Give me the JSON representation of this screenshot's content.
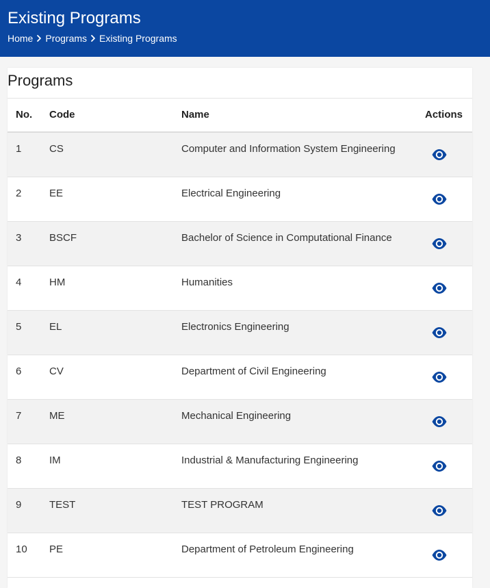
{
  "header": {
    "title": "Existing Programs",
    "breadcrumb": [
      "Home",
      "Programs",
      "Existing Programs"
    ]
  },
  "card": {
    "title": "Programs"
  },
  "table": {
    "columns": [
      "No.",
      "Code",
      "Name",
      "Actions"
    ],
    "rows": [
      {
        "no": "1",
        "code": "CS",
        "name": "Computer and Information System Engineering"
      },
      {
        "no": "2",
        "code": "EE",
        "name": "Electrical Engineering"
      },
      {
        "no": "3",
        "code": "BSCF",
        "name": "Bachelor of Science in Computational Finance"
      },
      {
        "no": "4",
        "code": "HM",
        "name": "Humanities"
      },
      {
        "no": "5",
        "code": "EL",
        "name": "Electronics Engineering"
      },
      {
        "no": "6",
        "code": "CV",
        "name": "Department of Civil Engineering"
      },
      {
        "no": "7",
        "code": "ME",
        "name": "Mechanical Engineering"
      },
      {
        "no": "8",
        "code": "IM",
        "name": "Industrial & Manufacturing Engineering"
      },
      {
        "no": "9",
        "code": "TEST",
        "name": "TEST PROGRAM"
      },
      {
        "no": "10",
        "code": "PE",
        "name": "Department of Petroleum Engineering"
      }
    ]
  },
  "icons": {
    "action": "eye-icon",
    "breadcrumb_separator": "chevron-right-icon"
  },
  "colors": {
    "header_bg": "#0b47a1",
    "accent": "#0b47a1",
    "row_stripe": "#f2f2f2"
  }
}
